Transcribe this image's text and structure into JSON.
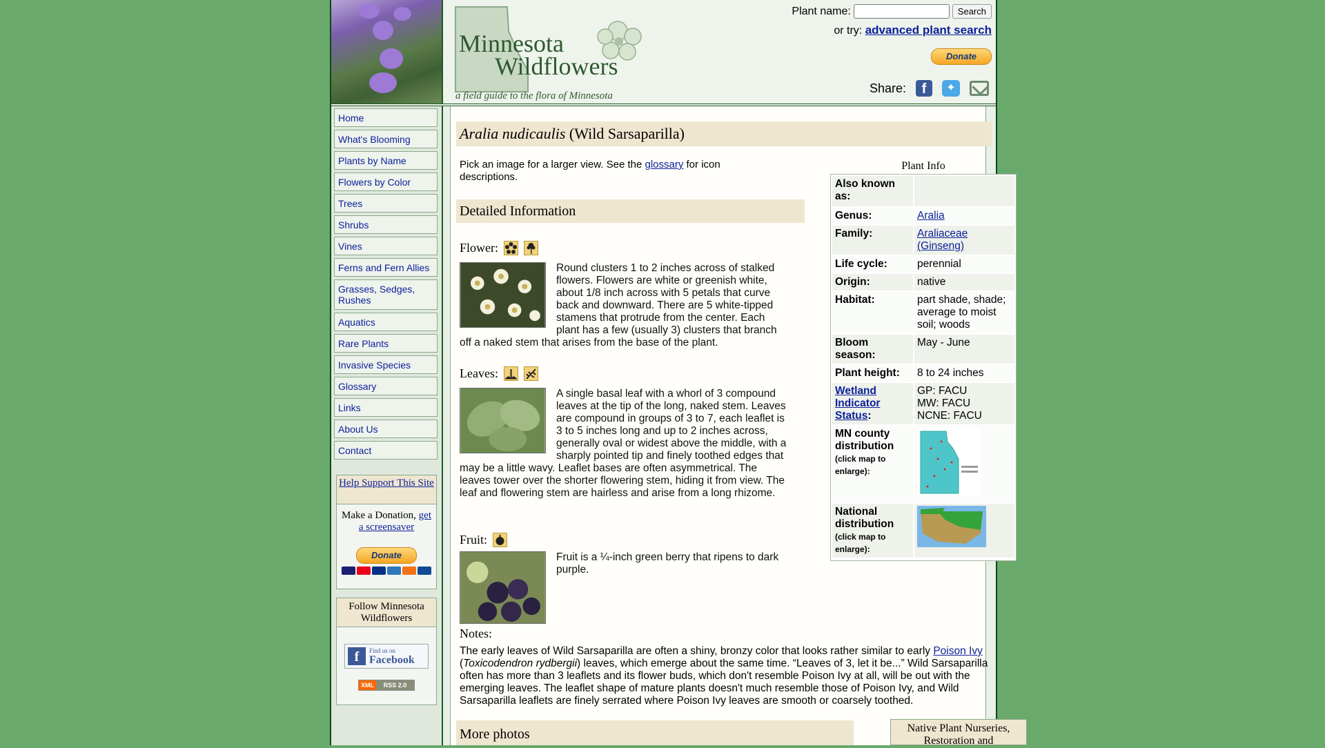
{
  "header": {
    "logo_line1": "Minnesota",
    "logo_line2": "Wildflowers",
    "tagline": "a field guide to the flora of Minnesota",
    "search_label": "Plant name:",
    "search_value": "",
    "search_button": "Search",
    "or_try": "or try:",
    "advanced_link": "advanced plant search",
    "donate_label": "Donate",
    "share_label": "Share:"
  },
  "nav": [
    {
      "label": "Home"
    },
    {
      "label": "What's Blooming"
    },
    {
      "label": "Plants by Name"
    },
    {
      "label": "Flowers by Color"
    },
    {
      "label": "Trees"
    },
    {
      "label": "Shrubs"
    },
    {
      "label": "Vines"
    },
    {
      "label": "Ferns and Fern Allies"
    },
    {
      "label": "Grasses, Sedges, Rushes"
    },
    {
      "label": "Aquatics"
    },
    {
      "label": "Rare Plants"
    },
    {
      "label": "Invasive Species"
    },
    {
      "label": "Glossary"
    },
    {
      "label": "Links"
    },
    {
      "label": "About Us"
    },
    {
      "label": "Contact"
    }
  ],
  "support": {
    "title": "Help Support This Site",
    "make_donation": "Make a Donation,",
    "screensaver_link": "get a screensaver",
    "donate_label": "Donate"
  },
  "follow": {
    "title": "Follow Minnesota Wildflowers",
    "fb_small": "Find us on",
    "fb_big": "Facebook",
    "rss_xml": "XML",
    "rss_label": "RSS 2.0"
  },
  "main": {
    "sci_name": "Aralia nudicaulis",
    "common_name": "(Wild Sarsaparilla)",
    "pick_text": "Pick an image for a larger view. See the",
    "glossary_link": "glossary",
    "pick_text_end": "for icon descriptions.",
    "detailed_heading": "Detailed Information",
    "flower_label": "Flower:",
    "flower_desc": "Round clusters 1 to 2 inches across of stalked flowers. Flowers are white or greenish white, about 1/8 inch across with 5 petals that curve back and downward. There are 5 white-tipped stamens that protrude from the center. Each plant has a few (usually 3) clusters that branch off a naked stem that arises from the base of the plant.",
    "leaves_label": "Leaves:",
    "leaves_desc": "A single basal leaf with a whorl of 3 compound leaves at the tip of the long, naked stem. Leaves are compound in groups of 3 to 7, each leaflet is 3 to 5 inches long and up to 2 inches across, generally oval or widest above the middle, with a sharply pointed tip and finely toothed edges that may be a little wavy. Leaflet bases are often asymmetrical. The leaves tower over the shorter flowering stem, hiding it from view. The leaf and flowering stem are hairless and arise from a long rhizome.",
    "fruit_label": "Fruit:",
    "fruit_desc": "Fruit is a ¼-inch green berry that ripens to dark purple.",
    "notes_label": "Notes:",
    "notes_pre": "The early leaves of Wild Sarsaparilla are often a shiny, bronzy color that looks rather similar to early",
    "notes_link": "Poison Ivy",
    "notes_sci": "Toxicodendron rydbergii",
    "notes_post": "leaves, which emerge about the same time. “Leaves of 3, let it be...” Wild Sarsaparilla often has more than 3 leaflets and its flower buds, which don't resemble Poison Ivy at all, will be out with the emerging leaves. The leaflet shape of mature plants doesn't much resemble those of Poison Ivy, and Wild Sarsaparilla leaflets are finely serrated where Poison Ivy leaves are smooth or coarsely toothed.",
    "more_photos": "More photos",
    "nursery_box": "Native Plant Nurseries, Restoration and"
  },
  "plant_info": {
    "heading": "Plant Info",
    "rows": [
      {
        "k": "Also known as:",
        "v": ""
      },
      {
        "k": "Genus:",
        "v": "Aralia"
      },
      {
        "k": "Family:",
        "v": "Araliaceae (Ginseng)"
      },
      {
        "k": "Life cycle:",
        "v": "perennial"
      },
      {
        "k": "Origin:",
        "v": "native"
      },
      {
        "k": "Habitat:",
        "v": "part shade, shade; average to moist soil; woods"
      },
      {
        "k": "Bloom season:",
        "v": "May - June"
      },
      {
        "k": "Plant height:",
        "v": "8 to 24 inches"
      }
    ],
    "wetland_label": "Wetland Indicator Status",
    "wetland_values": [
      "GP: FACU",
      "MW: FACU",
      "NCNE: FACU"
    ],
    "mn_county_label": "MN county distribution",
    "national_label": "National distribution",
    "click_map": "(click map to enlarge)"
  },
  "colors": {
    "page_bg": "#69a96b",
    "panel_bg": "#e8f0e8",
    "heading_bar": "#efe6d0",
    "link": "#0b1f9a"
  }
}
